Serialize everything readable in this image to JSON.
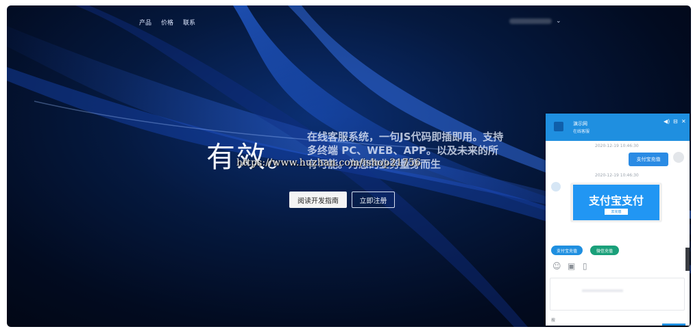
{
  "nav": {
    "items": [
      "产品",
      "价格",
      "联系"
    ]
  },
  "user_menu": {
    "chevron": "⌄"
  },
  "hero": {
    "title": "有效",
    "title_dot": "。",
    "description": "在线客服系统，一句JS代码即插即用。支持多终端 PC、WEB、APP。以及未来的所有可能。为您的业务量身而生"
  },
  "watermark": "https://www.huzhan.com/ishop21756",
  "buttons": {
    "guide": "阅读开发指南",
    "register": "立即注册"
  },
  "chat": {
    "name": "演示网",
    "status": "在线客服",
    "controls": {
      "sound": "◀)",
      "min": "⊟",
      "close": "✕"
    },
    "timestamps": [
      "2020-12-19 10:46:30",
      "2020-12-19 10:46:30"
    ],
    "user_message": "支付宝充值",
    "card": {
      "title": "支付宝支付",
      "button": "去充值"
    },
    "quick_replies": [
      "支付宝充值",
      "微信充值"
    ],
    "tools": {
      "emoji": "☺",
      "image": "▣",
      "file": "▯"
    },
    "footer": "按"
  },
  "colors": {
    "accent": "#1f8fe0",
    "wechat": "#1aa07a",
    "background": "#05193f"
  }
}
